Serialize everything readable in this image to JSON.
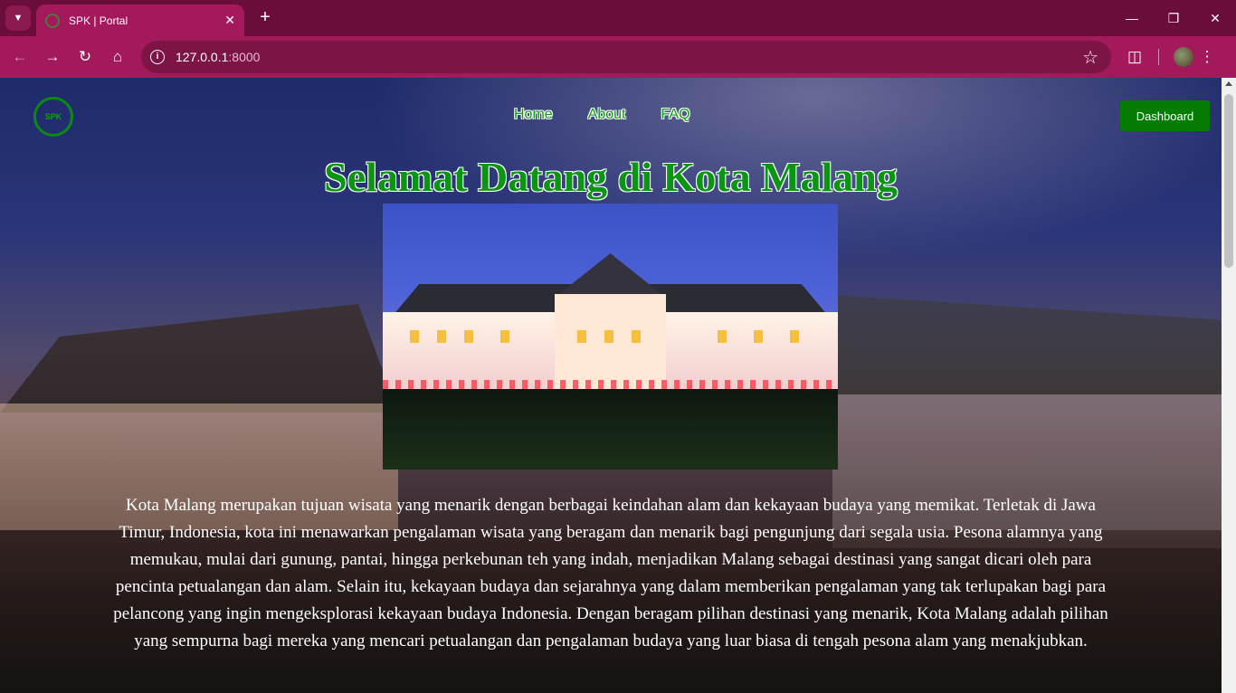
{
  "browser": {
    "tab_title": "SPK | Portal",
    "url_host": "127.0.0.1",
    "url_port": ":8000"
  },
  "nav": {
    "links": [
      "Home",
      "About",
      "FAQ"
    ],
    "dashboard_label": "Dashboard"
  },
  "hero": {
    "title": "Selamat Datang di Kota Malang",
    "description": "Kota Malang merupakan tujuan wisata yang menarik dengan berbagai keindahan alam dan kekayaan budaya yang memikat. Terletak di Jawa Timur, Indonesia, kota ini menawarkan pengalaman wisata yang beragam dan menarik bagi pengunjung dari segala usia. Pesona alamnya yang memukau, mulai dari gunung, pantai, hingga perkebunan teh yang indah, menjadikan Malang sebagai destinasi yang sangat dicari oleh para pencinta petualangan dan alam. Selain itu, kekayaan budaya dan sejarahnya yang dalam memberikan pengalaman yang tak terlupakan bagi para pelancong yang ingin mengeksplorasi kekayaan budaya Indonesia. Dengan beragam pilihan destinasi yang menarik, Kota Malang adalah pilihan yang sempurna bagi mereka yang mencari petualangan dan pengalaman budaya yang luar biasa di tengah pesona alam yang menakjubkan."
  },
  "colors": {
    "brand_green": "#057d05",
    "browser_frame": "#a3195b"
  }
}
